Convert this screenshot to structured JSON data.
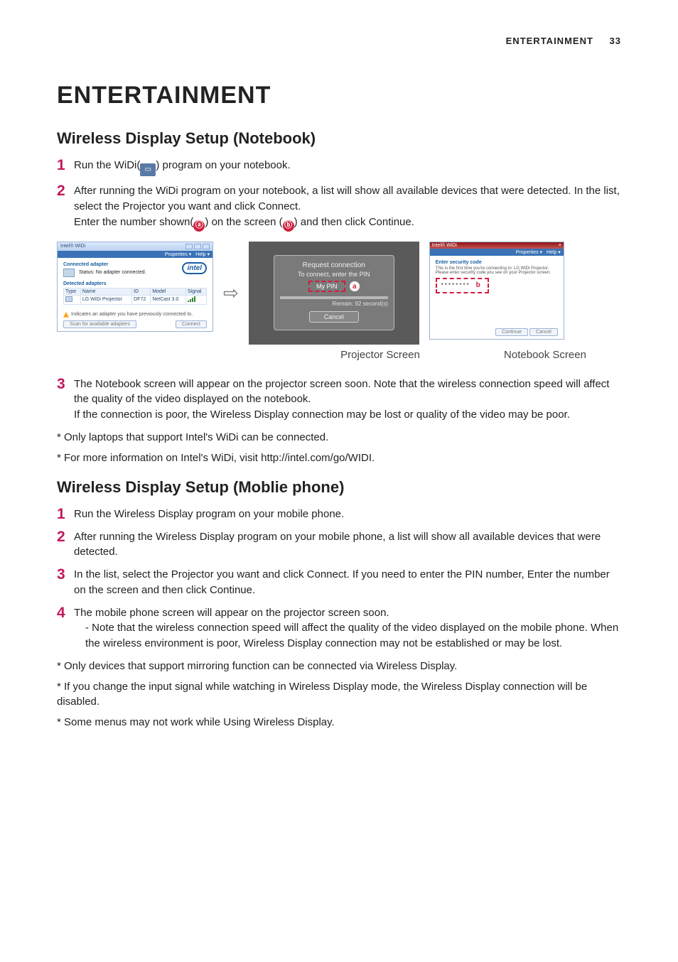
{
  "header": {
    "section": "ENTERTAINMENT",
    "page": "33"
  },
  "h1": "ENTERTAINMENT",
  "h2_notebook": "Wireless Display Setup (Notebook)",
  "h2_mobile": "Wireless Display Setup (Moblie phone)",
  "markers": {
    "a": "ⓐ",
    "b": "ⓑ"
  },
  "nb_steps": {
    "s1_pre": "Run the WiDi(",
    "s1_post": ") program on your notebook.",
    "s2_a": "After running the WiDi program on your notebook, a list will show all available devices that were detected. In the list, select the Projector you want and click Connect.",
    "s2_b_pre": "Enter the number shown(",
    "s2_b_mid": ") on the screen (",
    "s2_b_post": ") and then click Continue.",
    "s3_a": "The Notebook screen will appear on the projector screen soon. Note that the wireless connection speed will affect the quality of the video displayed on the notebook.",
    "s3_b": "If the connection is poor, the Wireless Display connection may be lost or quality of the video may be poor."
  },
  "nb_notes": {
    "n1": "* Only laptops that support Intel's WiDi can be connected.",
    "n2": "* For more information on Intel's WiDi, visit http://intel.com/go/WIDI."
  },
  "mb_steps": {
    "s1": "Run the Wireless Display program on your mobile phone.",
    "s2": "After running the Wireless Display program on your mobile phone, a list will show all available devices that were detected.",
    "s3": "In the list, select the Projector you want and click Connect. If you need to enter the PIN number, Enter the number on the screen and then click Continue.",
    "s4_a": "The mobile phone screen will appear on the projector screen soon.",
    "s4_b": "- Note that the wireless connection speed will affect the quality of the video displayed on the mobile phone. When the wireless environment is poor, Wireless Display connection may not be established or may be lost."
  },
  "mb_notes": {
    "n1": "* Only devices that support mirroring function can be connected via Wireless Display.",
    "n2": "* If you change the input signal while watching in Wireless Display mode, the Wireless Display connection will be disabled.",
    "n3": "* Some menus may not work while Using Wireless Display."
  },
  "captions": {
    "projector": "Projector Screen",
    "notebook": "Notebook Screen"
  },
  "widi": {
    "title": "Intel® WiDi",
    "menu_props": "Properties ▾",
    "menu_help": "Help ▾",
    "connected_hd": "Connected adapter",
    "status": "Status: No adapter connected.",
    "detected_hd": "Detected adapters",
    "cols": {
      "type": "Type",
      "name": "Name",
      "id": "ID",
      "model": "Model",
      "signal": "Signal"
    },
    "row": {
      "name": "LG WiDi Projector",
      "id": "DF72",
      "model": "NetCast 3.0"
    },
    "footnote": "Indicates an adapter you have previously connected to.",
    "scan": "Scan for available adapters",
    "connect": "Connect",
    "intel": "intel"
  },
  "proj": {
    "t1": "Request connection",
    "t2": "To connect, enter the PIN",
    "mypin": "My PIN",
    "remain": "Remain: 92 second(s)",
    "cancel": "Cancel",
    "a": "a"
  },
  "nb": {
    "title": "Intel® WiDi",
    "menu_props": "Properties ▾",
    "menu_help": "Help ▾",
    "hd": "Enter security code",
    "hint1": "This is the first time you're connecting to: LG WiDi Projector.",
    "hint2": "Please enter security code you see on your Projector screen:",
    "dots": "********",
    "b": "b",
    "continue": "Continue",
    "cancel": "Cancel"
  }
}
